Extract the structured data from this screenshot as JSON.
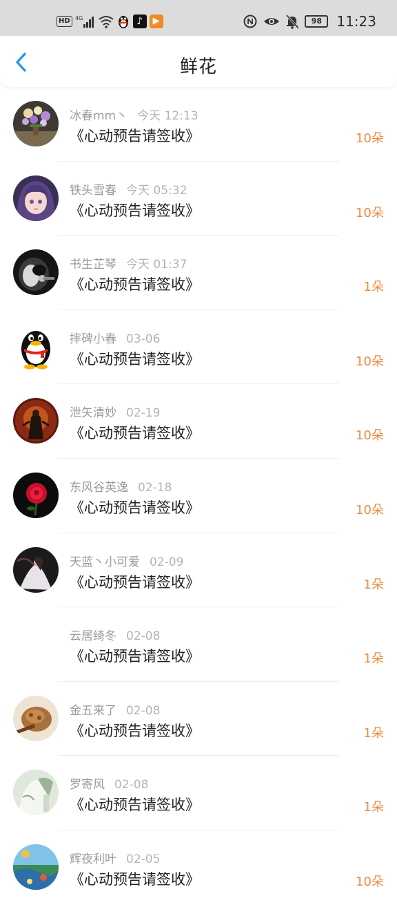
{
  "status_bar": {
    "hd": "HD",
    "network": "4G",
    "battery": "98",
    "time": "11:23"
  },
  "header": {
    "title": "鲜花"
  },
  "entries": [
    {
      "name": "冰春mm丶",
      "time": "今天 12:13",
      "gift": "《心动预告请签收》",
      "count": "10朵"
    },
    {
      "name": "铁头雪春",
      "time": "今天 05:32",
      "gift": "《心动预告请签收》",
      "count": "10朵"
    },
    {
      "name": "书生芷琴",
      "time": "今天 01:37",
      "gift": "《心动预告请签收》",
      "count": "1朵"
    },
    {
      "name": "摔碑小春",
      "time": "03-06",
      "gift": "《心动预告请签收》",
      "count": "10朵"
    },
    {
      "name": "泄矢清妙",
      "time": "02-19",
      "gift": "《心动预告请签收》",
      "count": "10朵"
    },
    {
      "name": "东风谷英逸",
      "time": "02-18",
      "gift": "《心动预告请签收》",
      "count": "10朵"
    },
    {
      "name": "天蓝丶小可爱",
      "time": "02-09",
      "gift": "《心动预告请签收》",
      "count": "1朵"
    },
    {
      "name": "云居绮冬",
      "time": "02-08",
      "gift": "《心动预告请签收》",
      "count": "1朵"
    },
    {
      "name": "金五来了",
      "time": "02-08",
      "gift": "《心动预告请签收》",
      "count": "1朵"
    },
    {
      "name": "罗寄风",
      "time": "02-08",
      "gift": "《心动预告请签收》",
      "count": "1朵"
    },
    {
      "name": "辉夜利叶",
      "time": "02-05",
      "gift": "《心动预告请签收》",
      "count": "10朵"
    }
  ],
  "colors": {
    "accent_blue": "#2196f3",
    "count_orange": "#ef8a3e",
    "status_bar_bg": "#dcdcdc"
  }
}
